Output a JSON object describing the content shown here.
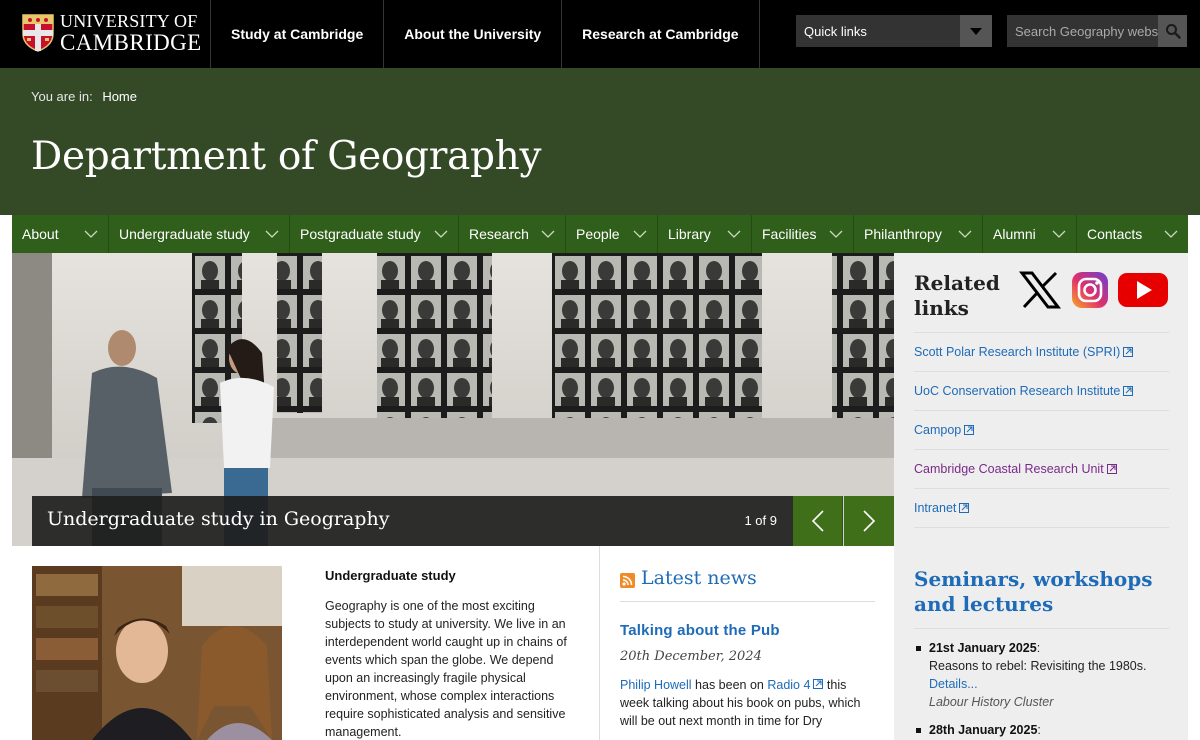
{
  "header": {
    "logo_line1": "UNIVERSITY OF",
    "logo_line2": "CAMBRIDGE",
    "nav": [
      "Study at Cambridge",
      "About the University",
      "Research at Cambridge"
    ],
    "quick_links": "Quick links",
    "search_placeholder": "Search Geography website"
  },
  "breadcrumb": {
    "prefix": "You are in:",
    "home": "Home"
  },
  "department_title": "Department of Geography",
  "subnav": [
    "About",
    "Undergraduate study",
    "Postgraduate study",
    "Research",
    "People",
    "Library",
    "Facilities",
    "Philanthropy",
    "Alumni",
    "Contacts"
  ],
  "hero": {
    "caption": "Undergraduate study in Geography",
    "counter": "1 of 9"
  },
  "sidebar": {
    "related_title": "Related links",
    "social": [
      "x-icon",
      "instagram-icon",
      "youtube-icon"
    ],
    "links": [
      "Scott Polar Research Institute (SPRI)",
      "UoC Conservation Research Institute",
      "Campop",
      "Cambridge Coastal Research Unit",
      "Intranet"
    ],
    "seminars_title": "Seminars, workshops and lectures",
    "seminars": [
      {
        "date": "21st January 2025",
        "desc": "Reasons to rebel: Revisiting the 1980s.",
        "details": "Details...",
        "cluster": "Labour History Cluster"
      },
      {
        "date": "28th January 2025",
        "desc": "",
        "details": "",
        "cluster": ""
      }
    ]
  },
  "undergrad": {
    "title": "Undergraduate study",
    "body": "Geography is one of the most exciting subjects to study at university. We live in an interdependent world caught up in chains of events which span the globe. We depend upon an increasingly fragile physical environment, whose complex interactions require sophisticated analysis and sensitive management."
  },
  "news": {
    "heading": "Latest news",
    "article_title": "Talking about the Pub",
    "article_date": "20th December, 2024",
    "author": "Philip Howell",
    "text1": "has been on",
    "radio": "Radio 4",
    "text2": "this week talking about his book on pubs, which will be out next month in time for Dry"
  },
  "colors": {
    "top_bar": "#000000",
    "dept_bg": "#344a26",
    "subnav_bg": "#2f5f1b",
    "accent_green": "#406f19",
    "link_blue": "#1e6bb8",
    "visited_purple": "#7a2a8a"
  }
}
